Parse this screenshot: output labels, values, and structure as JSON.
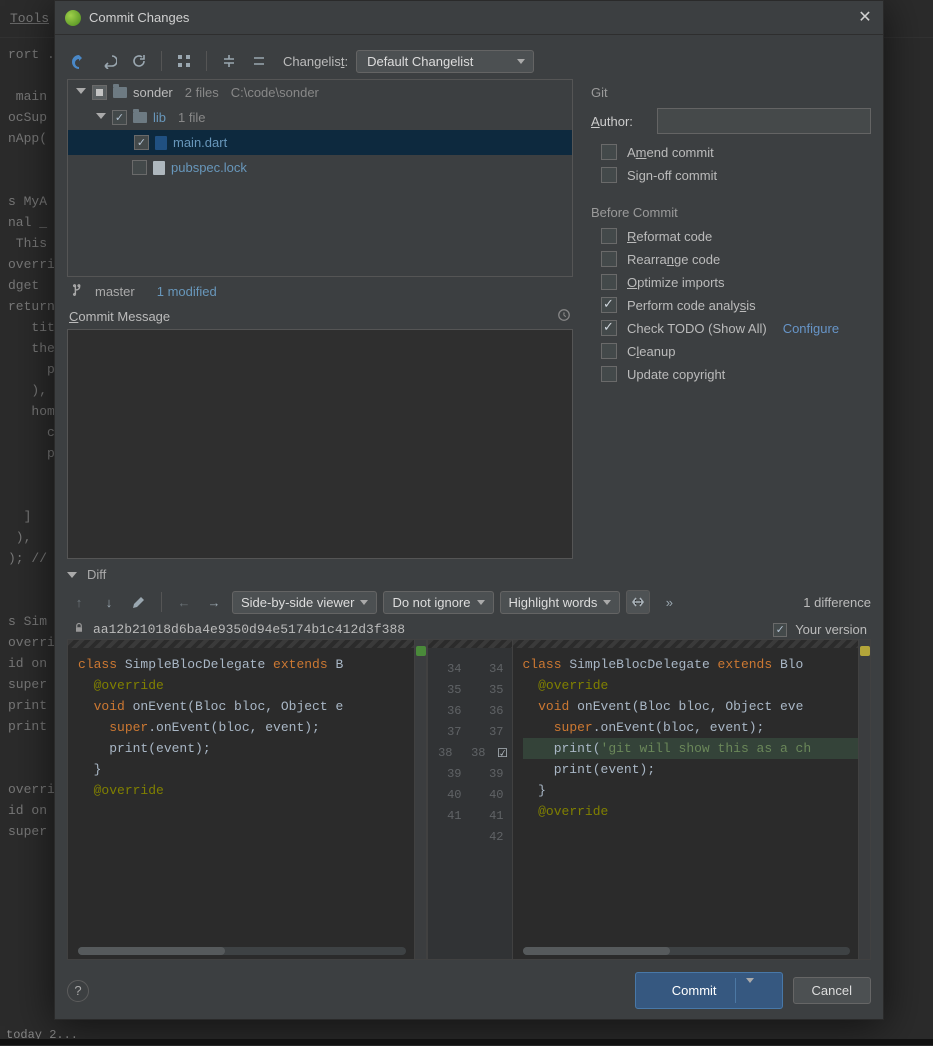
{
  "window": {
    "title": "Commit Changes"
  },
  "behind": {
    "menu_item": "Tools",
    "editor_excerpt": "rort ..\n\n main\nocSup\nnApp(\n\n\ns MyA\nnal _\n This\noverri\ndget \nreturn\n   tit\n   the\n     p\n   ),\n   hom\n     c\n     p\n\n\n  ]\n ),\n); //\n\n\ns Sim\noverri\nid on\nsuper\nprint\nprint\n\n\noverri\nid on\nsuper",
    "statusbar": "today 2..."
  },
  "toolbar": {
    "changelist_label": "Changelist:",
    "changelist_value": "Default Changelist"
  },
  "git": {
    "section": "Git",
    "author_label": "Author:",
    "author_value": "",
    "amend": "Amend commit",
    "signoff": "Sign-off commit"
  },
  "tree": {
    "root_name": "sonder",
    "root_meta_files": "2 files",
    "root_meta_path": "C:\\code\\sonder",
    "lib_name": "lib",
    "lib_meta": "1 file",
    "main_name": "main.dart",
    "pubspec_name": "pubspec.lock"
  },
  "branchbar": {
    "branch": "master",
    "modified": "1 modified"
  },
  "commit_message": {
    "label": "Commit Message",
    "value": ""
  },
  "before_commit": {
    "title": "Before Commit",
    "reformat": "Reformat code",
    "rearrange": "Rearrange code",
    "optimize": "Optimize imports",
    "analysis": "Perform code analysis",
    "todo": "Check TODO (Show All)",
    "todo_configure": "Configure",
    "cleanup": "Cleanup",
    "copyright": "Update copyright"
  },
  "diff": {
    "label": "Diff",
    "viewer": "Side-by-side viewer",
    "whitespace": "Do not ignore",
    "highlight": "Highlight words",
    "count": "1 difference",
    "hash": "aa12b21018d6ba4e9350d94e5174b1c412d3f388",
    "your_version": "Your version",
    "left_lines": [
      "class SimpleBlocDelegate extends B",
      "  @override",
      "  void onEvent(Bloc bloc, Object e",
      "    super.onEvent(bloc, event);",
      "    print(event);",
      "  }",
      "",
      "  @override"
    ],
    "right_lines": [
      "class SimpleBlocDelegate extends Blo",
      "  @override",
      "  void onEvent(Bloc bloc, Object eve",
      "    super.onEvent(bloc, event);",
      "    print('git will show this as a ch",
      "    print(event);",
      "  }",
      "",
      "  @override"
    ],
    "gutter_left": [
      "34",
      "35",
      "36",
      "37",
      "38",
      "39",
      "40",
      "41",
      ""
    ],
    "gutter_right": [
      "34",
      "35",
      "36",
      "37",
      "38",
      "39",
      "40",
      "41",
      "42"
    ]
  },
  "footer": {
    "commit": "Commit",
    "cancel": "Cancel"
  }
}
